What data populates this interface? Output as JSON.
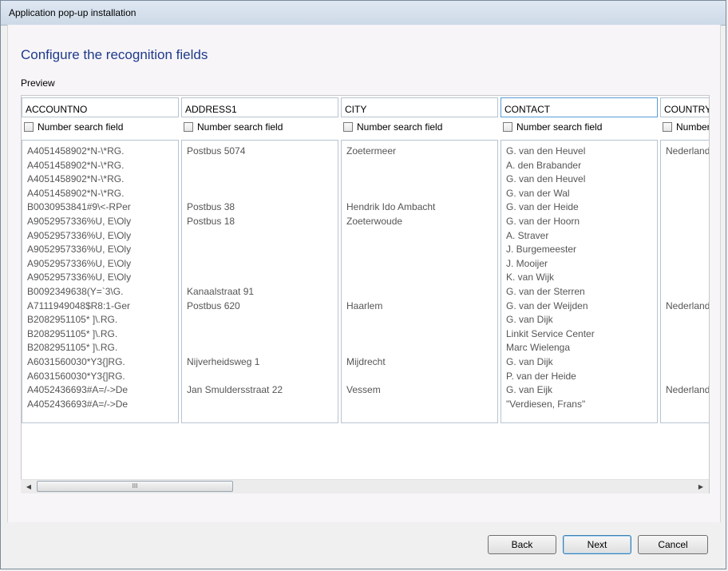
{
  "window": {
    "title": "Application pop-up installation"
  },
  "page": {
    "heading": "Configure the recognition fields",
    "preview_label": "Preview"
  },
  "columns": [
    {
      "field": "ACCOUNTNO",
      "checkbox_label": "Number search field",
      "values": [
        "A4051458902*N-\\*RG.",
        "A4051458902*N-\\*RG.",
        "A4051458902*N-\\*RG.",
        "A4051458902*N-\\*RG.",
        "B0030953841#9\\<-RPer",
        "A9052957336%U, E\\Oly",
        "A9052957336%U, E\\Oly",
        "A9052957336%U, E\\Oly",
        "A9052957336%U, E\\Oly",
        "A9052957336%U, E\\Oly",
        "B0092349638(Y=`3\\G.",
        "A7111949048$R8:1-Ger",
        "B2082951105* ]\\.RG.",
        "B2082951105* ]\\.RG.",
        "B2082951105* ]\\.RG.",
        "A6031560030*Y3{]RG.",
        "A6031560030*Y3{]RG.",
        "A4052436693#A=/->De",
        "A4052436693#A=/->De"
      ]
    },
    {
      "field": "ADDRESS1",
      "checkbox_label": "Number search field",
      "values": [
        "Postbus 5074",
        "",
        "",
        "",
        "Postbus 38",
        "Postbus 18",
        "",
        "",
        "",
        "",
        "Kanaalstraat 91",
        "Postbus 620",
        "",
        "",
        "",
        "Nijverheidsweg 1",
        "",
        "Jan Smuldersstraat 22",
        ""
      ]
    },
    {
      "field": "CITY",
      "checkbox_label": "Number search field",
      "values": [
        "Zoetermeer",
        "",
        "",
        "",
        "Hendrik Ido Ambacht",
        "Zoeterwoude",
        "",
        "",
        "",
        "",
        "",
        "Haarlem",
        "",
        "",
        "",
        "Mijdrecht",
        "",
        "Vessem",
        ""
      ]
    },
    {
      "field": "CONTACT",
      "checkbox_label": "Number search field",
      "values": [
        "G. van den Heuvel",
        "A. den Brabander",
        "G. van den Heuvel",
        "G. van der Wal",
        "G. van der Heide",
        "G. van der Hoorn",
        "A. Straver",
        "J. Burgemeester",
        "J. Mooijer",
        "K. van Wijk",
        "G. van der Sterren",
        "G. van der Weijden",
        "G. van Dijk",
        "Linkit Service Center",
        "Marc Wielenga",
        "G. van Dijk",
        "P. van der Heide",
        "G. van Eijk",
        "\"Verdiesen, Frans\""
      ]
    },
    {
      "field": "COUNTRY",
      "checkbox_label": "Number search field",
      "values": [
        "Nederland",
        "",
        "",
        "",
        "",
        "",
        "",
        "",
        "",
        "",
        "",
        "Nederland",
        "",
        "",
        "",
        "",
        "",
        "Nederland",
        ""
      ]
    }
  ],
  "scrollbar": {
    "left_arrow": "◀",
    "right_arrow": "▶",
    "thumb_grip": "III"
  },
  "buttons": {
    "back": "Back",
    "next": "Next",
    "cancel": "Cancel"
  }
}
